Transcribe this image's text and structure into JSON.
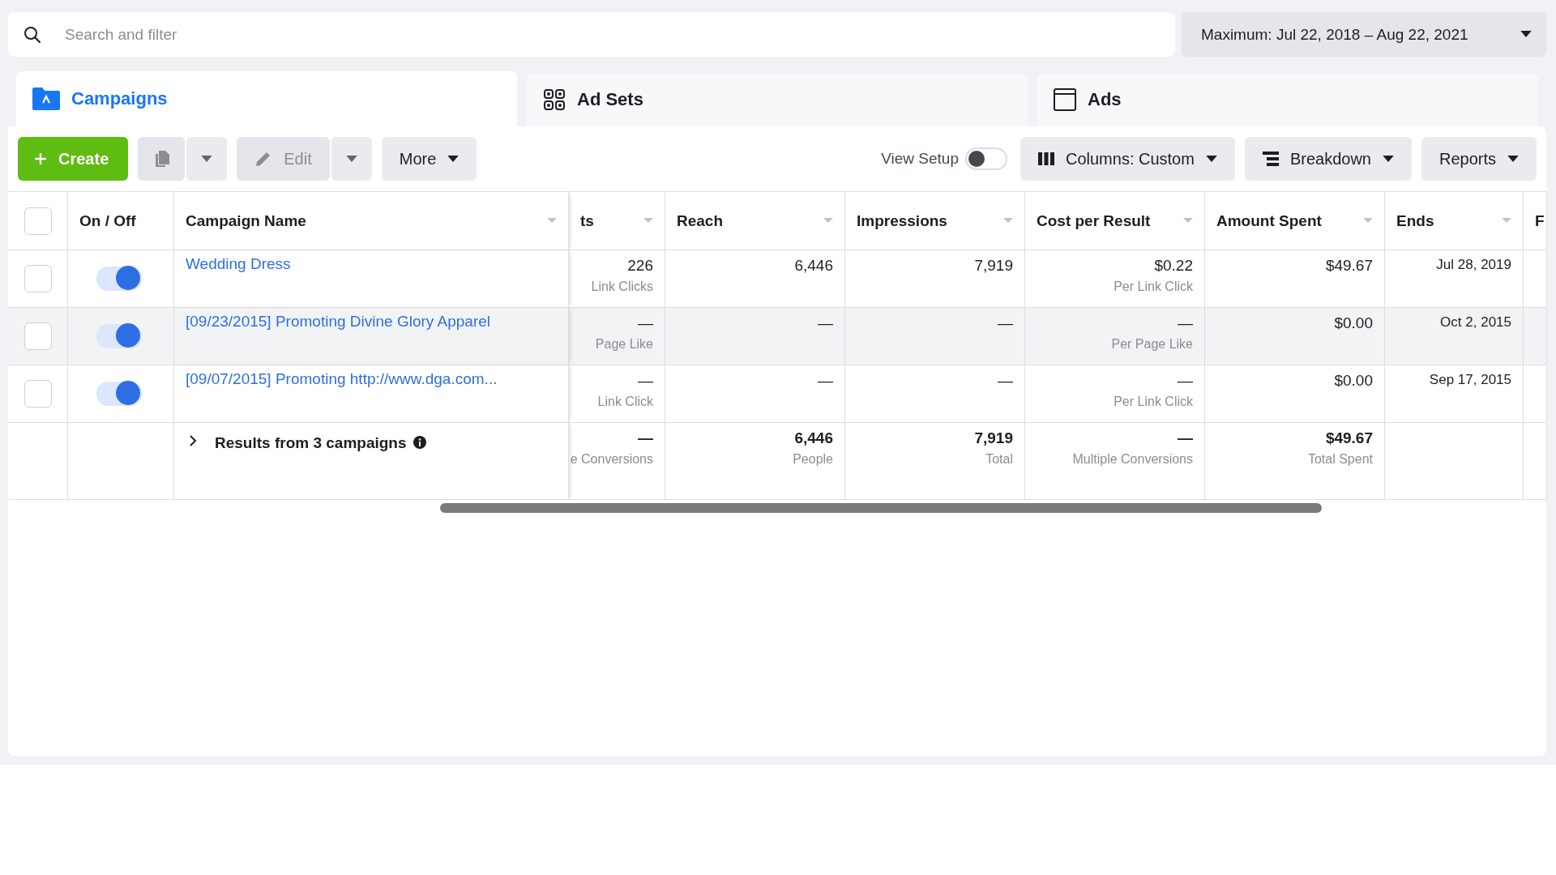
{
  "search": {
    "placeholder": "Search and filter"
  },
  "date_range": {
    "label": "Maximum: Jul 22, 2018 – Aug 22, 2021"
  },
  "tabs": [
    {
      "label": "Campaigns",
      "kind": "campaigns",
      "selected": true
    },
    {
      "label": "Ad Sets",
      "kind": "adsets",
      "selected": false
    },
    {
      "label": "Ads",
      "kind": "ads",
      "selected": false
    }
  ],
  "toolbar": {
    "create": "Create",
    "duplicate": {
      "disabled": true
    },
    "edit": {
      "label": "Edit",
      "disabled": true
    },
    "more": "More",
    "view_setup": {
      "label": "View Setup",
      "on": false
    },
    "columns": "Columns: Custom",
    "breakdown": "Breakdown",
    "reports": "Reports"
  },
  "table": {
    "select_all": {
      "checked": false
    },
    "columns": [
      {
        "label": "On / Off",
        "sortable": false
      },
      {
        "label": "Campaign Name",
        "sortable": true
      },
      {
        "label": "ts",
        "sortable": true
      },
      {
        "label": "Reach",
        "sortable": true
      },
      {
        "label": "Impressions",
        "sortable": true
      },
      {
        "label": "Cost per Result",
        "sortable": true
      },
      {
        "label": "Amount Spent",
        "sortable": true
      },
      {
        "label": "Ends",
        "sortable": true
      },
      {
        "label": "F"
      }
    ],
    "rows": [
      {
        "checked": false,
        "on": true,
        "highlighted": false,
        "name": "Wedding Dress",
        "metrics": [
          {
            "value": "226",
            "sub": "Link Clicks"
          },
          {
            "value": "6,446"
          },
          {
            "value": "7,919"
          },
          {
            "value": "$0.22",
            "sub": "Per Link Click"
          },
          {
            "value": "$49.67"
          }
        ],
        "ends": "Jul 28, 2019"
      },
      {
        "checked": false,
        "on": true,
        "highlighted": true,
        "name": "[09/23/2015] Promoting Divine Glory Apparel",
        "metrics": [
          {
            "value": "—",
            "sub": "Page Like"
          },
          {
            "value": "—"
          },
          {
            "value": "—"
          },
          {
            "value": "—",
            "sub": "Per Page Like"
          },
          {
            "value": "$0.00"
          }
        ],
        "ends": "Oct 2, 2015"
      },
      {
        "checked": false,
        "on": true,
        "highlighted": false,
        "name": "[09/07/2015] Promoting http://www.dga.com...",
        "metrics": [
          {
            "value": "—",
            "sub": "Link Click"
          },
          {
            "value": "—"
          },
          {
            "value": "—"
          },
          {
            "value": "—",
            "sub": "Per Link Click"
          },
          {
            "value": "$0.00"
          }
        ],
        "ends": "Sep 17, 2015"
      }
    ],
    "summary": {
      "label": "Results from 3 campaigns",
      "metrics": [
        {
          "value": "—",
          "sub": "e Conversions"
        },
        {
          "value": "6,446",
          "sub": "People"
        },
        {
          "value": "7,919",
          "sub": "Total"
        },
        {
          "value": "—",
          "sub": "Multiple Conversions"
        },
        {
          "value": "$49.67",
          "sub": "Total Spent"
        }
      ]
    }
  }
}
